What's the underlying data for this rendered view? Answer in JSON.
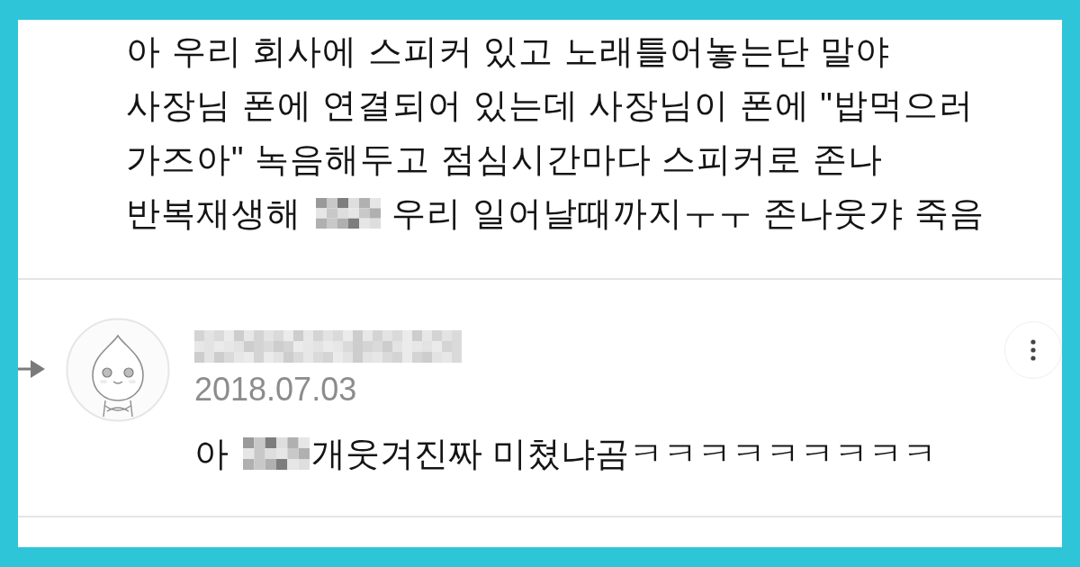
{
  "post": {
    "lines": [
      {
        "segments": [
          {
            "kind": "text",
            "text": "아 우리 회사에 스피커 있고 노래틀어놓는단 말야"
          }
        ]
      },
      {
        "segments": [
          {
            "kind": "text",
            "text": "사장님 폰에 연결되어 있는데 사장님이 폰에 \"밥먹으러"
          }
        ]
      },
      {
        "segments": [
          {
            "kind": "text",
            "text": "가즈아\" 녹음해두고 점심시간마다 스피커로 존나"
          }
        ]
      },
      {
        "segments": [
          {
            "kind": "text",
            "text": "반복재생해"
          },
          {
            "kind": "blur"
          },
          {
            "kind": "text",
            "text": "우리 일어날때까지ㅜㅜ 존나웃갸 죽음"
          }
        ]
      }
    ]
  },
  "comment": {
    "name_blurred": true,
    "date": "2018.07.03",
    "segments": [
      {
        "kind": "text",
        "text": "아"
      },
      {
        "kind": "blur"
      },
      {
        "kind": "text",
        "text": "개웃겨진짜 미쳤냐곰ㅋㅋㅋㅋㅋㅋㅋㅋㅋ"
      }
    ]
  }
}
